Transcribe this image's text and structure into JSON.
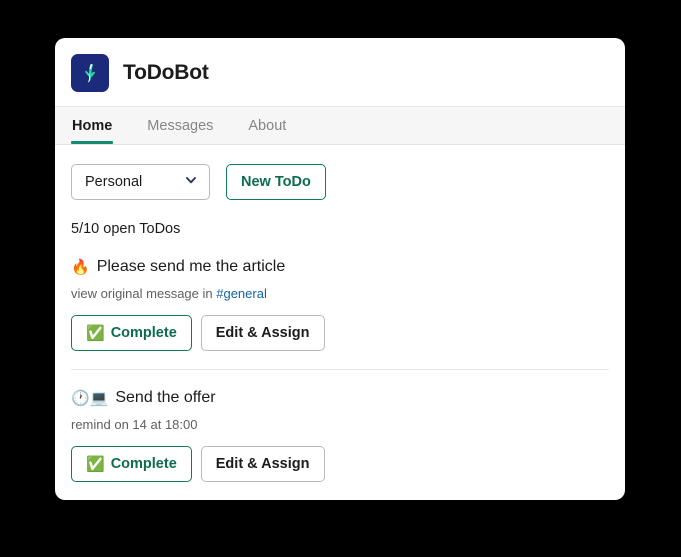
{
  "window": {
    "background_color": "#000000"
  },
  "app": {
    "title": "ToDoBot",
    "logo_icon": "todobot-logo-icon",
    "logo_bg_color": "#1b2a7a",
    "logo_glyph_color": "#2fd4a6"
  },
  "tabs": [
    {
      "label": "Home",
      "active": true
    },
    {
      "label": "Messages",
      "active": false
    },
    {
      "label": "About",
      "active": false
    }
  ],
  "accent": {
    "green": "#0f7b5a",
    "tab_underline": "#128a6e",
    "link_blue": "#1264a3"
  },
  "controls": {
    "workspace_select": {
      "value": "Personal",
      "chevron_icon": "chevron-down-icon"
    },
    "new_todo_button": "New ToDo"
  },
  "summary": "5/10 open ToDos",
  "todos": [
    {
      "emoji": "🔥",
      "emoji_name": "fire-emoji",
      "title": "Please send me the article",
      "meta_prefix": "view original message in ",
      "meta_link": "#general",
      "complete_label": "Complete",
      "complete_emoji": "✅",
      "edit_label": "Edit & Assign"
    },
    {
      "emoji": "🕐💻",
      "emoji_name": "clock-laptop-emoji",
      "title": "Send the offer",
      "meta_prefix": "remind on 14 at 18:00",
      "meta_link": "",
      "complete_label": "Complete",
      "complete_emoji": "✅",
      "edit_label": "Edit & Assign"
    }
  ]
}
